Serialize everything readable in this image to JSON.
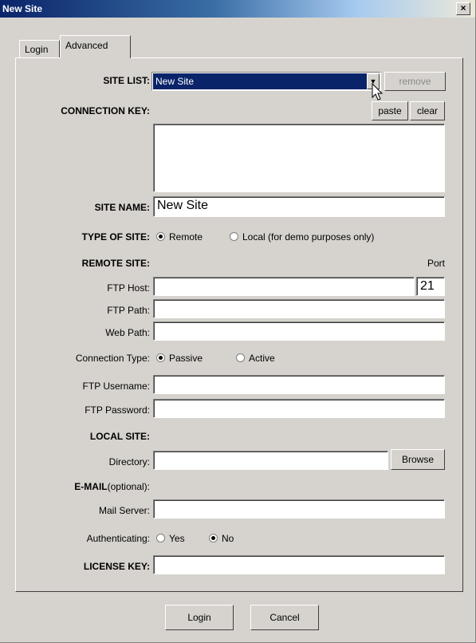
{
  "window": {
    "title": "New Site",
    "close_glyph": "×"
  },
  "tabs": [
    "Login",
    "Advanced"
  ],
  "site_list": {
    "label": "SITE LIST:",
    "value": "New Site",
    "remove": "remove"
  },
  "connection_key": {
    "label": "CONNECTION KEY:",
    "paste": "paste",
    "clear": "clear",
    "value": ""
  },
  "site_name": {
    "label": "SITE NAME:",
    "value": "New Site"
  },
  "type_of_site": {
    "label": "TYPE OF SITE:",
    "remote": "Remote",
    "local": "Local  (for demo purposes only)",
    "selected": "Remote"
  },
  "remote_site": {
    "label": "REMOTE SITE:",
    "port_label": "Port",
    "ftp_host_label": "FTP Host:",
    "ftp_host": "",
    "port": "21",
    "ftp_path_label": "FTP Path:",
    "ftp_path": "",
    "web_path_label": "Web Path:",
    "web_path": "",
    "connection_type_label": "Connection Type:",
    "passive": "Passive",
    "active": "Active",
    "selected": "Passive",
    "username_label": "FTP Username:",
    "username": "",
    "password_label": "FTP Password:",
    "password": ""
  },
  "local_site": {
    "label": "LOCAL SITE:",
    "directory_label": "Directory:",
    "directory": "",
    "browse": "Browse"
  },
  "email": {
    "label_bold": "E-MAIL",
    "label_note": "(optional):",
    "mail_server_label": "Mail Server:",
    "mail_server": "",
    "auth_label": "Authenticating:",
    "yes": "Yes",
    "no": "No",
    "selected": "No"
  },
  "license": {
    "label": "LICENSE KEY:",
    "value": ""
  },
  "footer": {
    "login": "Login",
    "cancel": "Cancel"
  },
  "icons": [
    "close-icon",
    "dropdown-arrow-icon",
    "mouse-cursor-icon"
  ]
}
